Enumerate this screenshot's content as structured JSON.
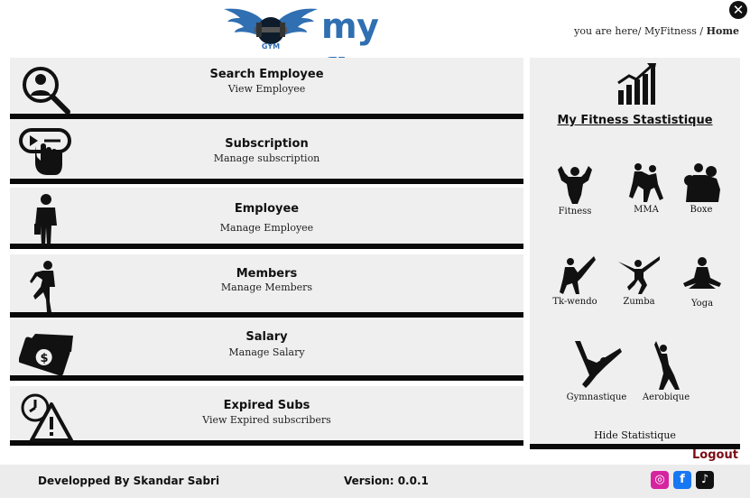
{
  "header": {
    "logo_text": "my fitness",
    "logo_badge": "GYM",
    "breadcrumb_prefix": "you are here/",
    "breadcrumb_app": "MyFitness",
    "breadcrumb_separator": "/",
    "breadcrumb_current": "Home",
    "close_label": "✕"
  },
  "menu": [
    {
      "title": "Search Employee",
      "subtitle": "View Employee",
      "icon": "search-employee-icon"
    },
    {
      "title": "Subscription",
      "subtitle": "Manage subscription",
      "icon": "subscription-icon"
    },
    {
      "title": "Employee",
      "subtitle": "Manage Employee",
      "icon": "employee-icon"
    },
    {
      "title": "Members",
      "subtitle": "Manage Members",
      "icon": "members-icon"
    },
    {
      "title": "Salary",
      "subtitle": "Manage Salary",
      "icon": "salary-icon"
    },
    {
      "title": "Expired Subs",
      "subtitle": "View Expired subscribers",
      "icon": "expired-subs-icon"
    }
  ],
  "stats": {
    "title": "My Fitness Stastistique",
    "sports": [
      "Fitness",
      "MMA",
      "Boxe",
      "Tk-wendo",
      "Zumba",
      "Yoga",
      "Gymnastique",
      "Aerobique"
    ],
    "hide_label": "Hide Statistique"
  },
  "logout_label": "Logout",
  "footer": {
    "developer": "Developped By Skandar Sabri",
    "version": "Version: 0.0.1",
    "social": {
      "instagram": "◎",
      "facebook": "f",
      "tiktok": "♪"
    }
  },
  "colors": {
    "logo_blue": "#2f6fb2",
    "logout": "#7a0c12",
    "card_bg": "#efefef",
    "instagram": "#d6249f",
    "facebook": "#1877f2",
    "tiktok": "#111111"
  }
}
